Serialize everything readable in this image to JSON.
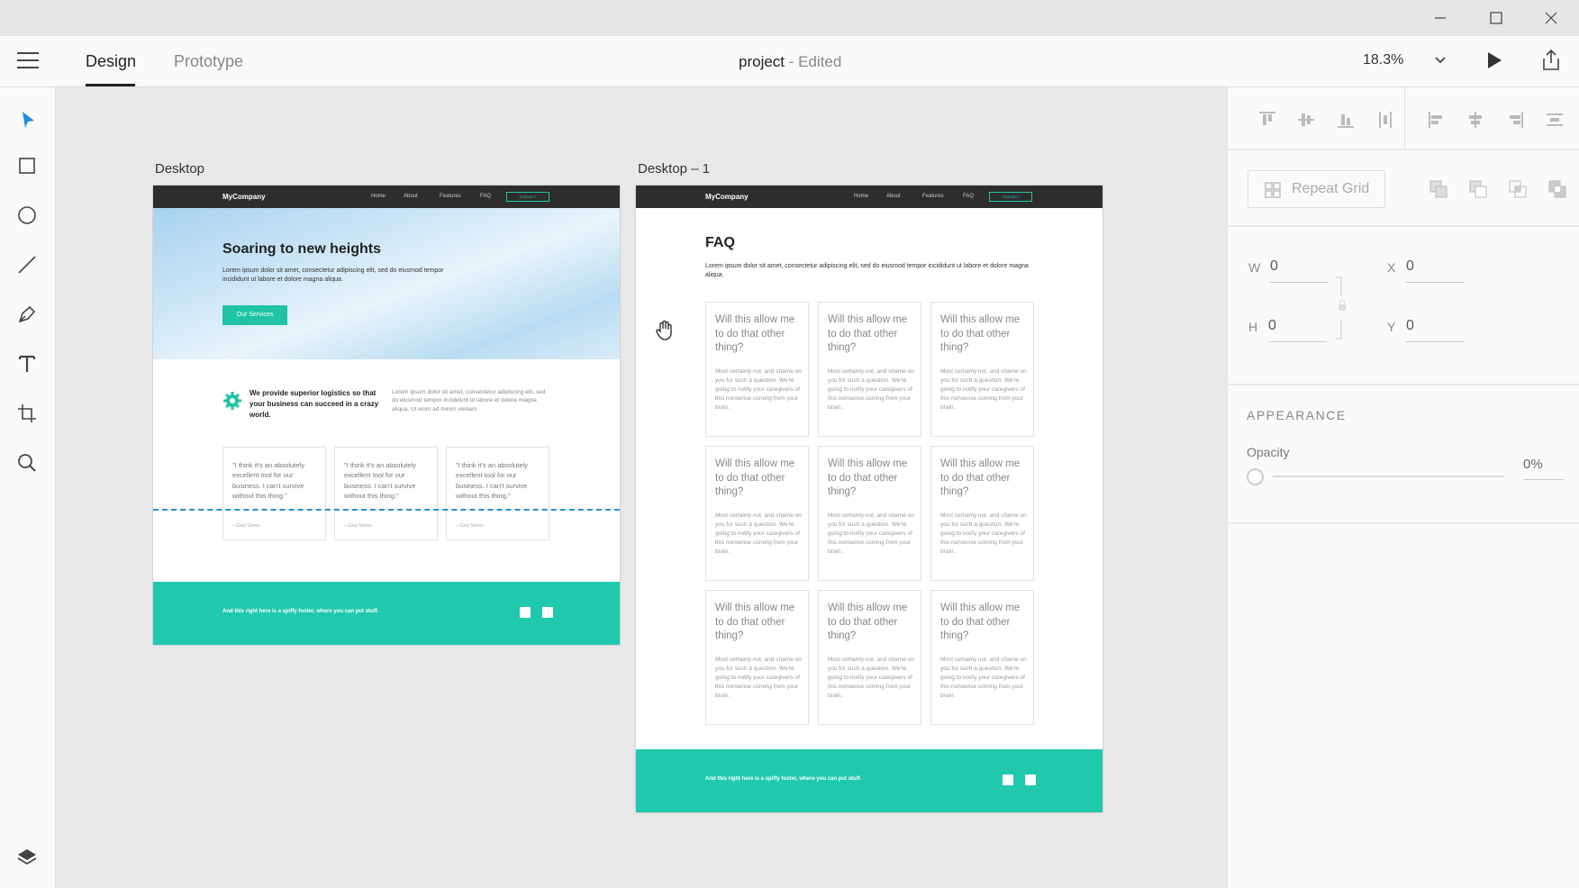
{
  "window": {
    "minimize_icon": "minimize-icon",
    "maximize_icon": "maximize-icon",
    "close_icon": "close-icon"
  },
  "menubar": {
    "tabs": [
      {
        "label": "Design",
        "active": true
      },
      {
        "label": "Prototype",
        "active": false
      }
    ],
    "doc_name": "project",
    "doc_status": " - Edited",
    "zoom": "18.3%"
  },
  "toolbar": {
    "tools": [
      "select-tool",
      "rectangle-tool",
      "ellipse-tool",
      "line-tool",
      "pen-tool",
      "text-tool",
      "artboard-tool",
      "zoom-tool"
    ],
    "bottom": "layers-icon"
  },
  "artboards": {
    "desktop": {
      "label": "Desktop",
      "brand": "MyCompany",
      "nav": [
        "Home",
        "About",
        "Features",
        "FAQ"
      ],
      "nav_button": "CONTACT",
      "hero_title": "Soaring to new heights",
      "hero_text": "Lorem ipsum dolor sit amet, consectetur adipiscing elit, sed do eiusmod tempor incididunt ut labore et dolore magna aliqua.",
      "hero_button": "Our Services",
      "feature_head": "We provide superior logistics so that your business can succeed in a crazy world.",
      "feature_text": "Lorem ipsum dolor sit amet, consectetur adipiscing elit, sed do eiusmod tempor incididunt ut labore et dolore magna aliqua. Ut enim ad minim veniam.",
      "testimonials": [
        {
          "quote": "\"I think it's an absolutely excellent tool for our business. I can't survive without this thing.\"",
          "author": "– Gary Simon"
        },
        {
          "quote": "\"I think it's an absolutely excellent tool for our business. I can't survive without this thing.\"",
          "author": "– Gary Simon"
        },
        {
          "quote": "\"I think it's an absolutely excellent tool for our business. I can't survive without this thing.\"",
          "author": "– Gary Simon"
        }
      ],
      "footer": "And this right here is a spiffy footer, where you can put stuff."
    },
    "desktop1": {
      "label": "Desktop – 1",
      "brand": "MyCompany",
      "nav": [
        "Home",
        "About",
        "Features",
        "FAQ"
      ],
      "nav_button": "CONTACT",
      "faq_title": "FAQ",
      "faq_text": "Lorem ipsum dolor sit amet, consectetur adipiscing elit, sed do eiusmod tempor incididunt ut labore et dolore magna aliqua.",
      "question": "Will this allow me to do that other thing?",
      "answer": "Most certainly not, and shame on you for such a question. We're going to notify your caregivers of this nonsense coming from your brain.",
      "footer": "And this right here is a spiffy footer, where you can put stuff."
    }
  },
  "props": {
    "repeat_grid": "Repeat Grid",
    "w_label": "W",
    "w_value": "0",
    "h_label": "H",
    "h_value": "0",
    "x_label": "X",
    "x_value": "0",
    "y_label": "Y",
    "y_value": "0",
    "appearance": "APPEARANCE",
    "opacity_label": "Opacity",
    "opacity_value": "0%"
  },
  "colors": {
    "accent_teal": "#20c9ad",
    "select_blue": "#1f8fe0",
    "nav_dark": "#2d2d2d"
  }
}
